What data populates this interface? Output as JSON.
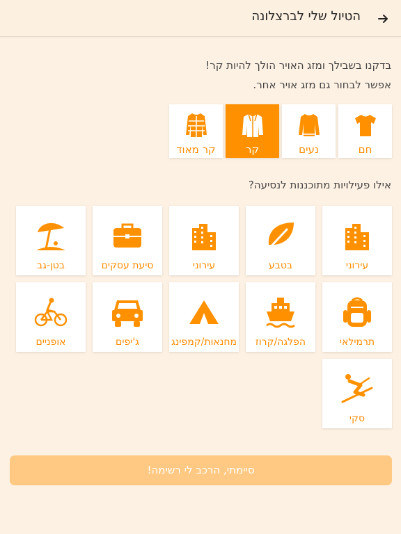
{
  "header": {
    "title": "הטיול שלי לברצלונה",
    "back_icon": "arrow-right-icon"
  },
  "intro": {
    "line1": "בדקנו בשבילך ומזג האויר הולך להיות קר!",
    "line2": "אפשר לבחור גם מזג אויר אחר."
  },
  "weather": [
    {
      "label": "חם",
      "icon": "tshirt-icon",
      "selected": false
    },
    {
      "label": "נעים",
      "icon": "sweater-icon",
      "selected": false
    },
    {
      "label": "קר",
      "icon": "jacket-icon",
      "selected": true
    },
    {
      "label": "קר מאוד",
      "icon": "puffer-jacket-icon",
      "selected": false
    }
  ],
  "activities_prompt": "אילו פעילויות מתוכננות לנסיעה?",
  "activities": [
    {
      "label": "עירוני",
      "icon": "city-icon"
    },
    {
      "label": "בטבע",
      "icon": "leaf-icon"
    },
    {
      "label": "עירוני",
      "icon": "city-icon"
    },
    {
      "label": "סיעת עסקים",
      "icon": "briefcase-icon"
    },
    {
      "label": "בטן-גב",
      "icon": "beach-umbrella-icon"
    },
    {
      "label": "תרמילאי",
      "icon": "backpack-icon"
    },
    {
      "label": "הפלגה/קרוז",
      "icon": "ship-icon"
    },
    {
      "label": "מחנאות/קמפינג",
      "icon": "tent-icon"
    },
    {
      "label": "ג'יפים",
      "icon": "jeep-icon"
    },
    {
      "label": "אופניים",
      "icon": "bicycle-icon"
    },
    {
      "label": "סקי",
      "icon": "ski-icon"
    }
  ],
  "done_button": "סיימתי, הרכב לי רשימה!",
  "colors": {
    "accent": "#ff9100",
    "background": "#fdf1e3",
    "button": "#ffc983"
  }
}
